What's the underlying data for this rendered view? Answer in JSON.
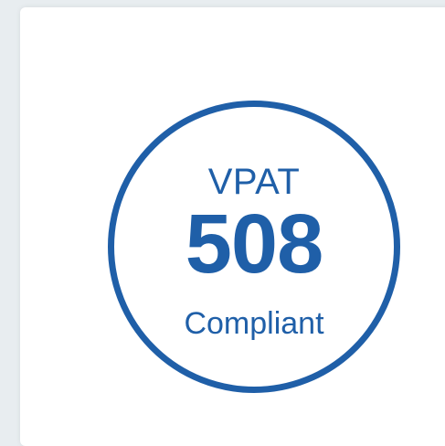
{
  "colors": {
    "background": "#e8edf0",
    "card": "#ffffff",
    "badge_blue": "#1f5fa8"
  },
  "badge": {
    "top_text": "VPAT",
    "number": "508",
    "bottom_text": "Compliant"
  }
}
